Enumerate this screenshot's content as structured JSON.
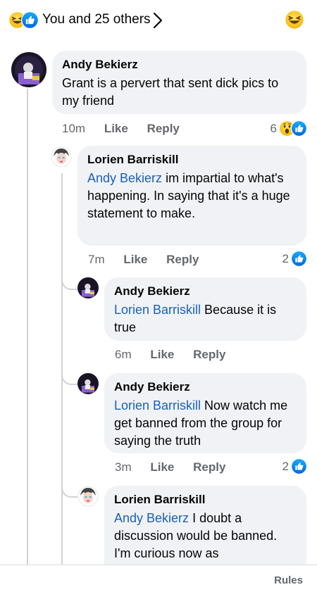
{
  "header": {
    "reaction_icons": [
      "laugh-icon",
      "like-icon"
    ],
    "summary": "You and 25 others",
    "right_emoji": "laugh-icon"
  },
  "comments": [
    {
      "author": "Andy Bekierz",
      "mention": "",
      "text": "Grant is a pervert that sent dick pics to my friend",
      "time": "10m",
      "like": "Like",
      "reply": "Reply",
      "reaction_count": "6",
      "reaction_icons": [
        "wow-icon",
        "like-icon"
      ]
    },
    {
      "author": "Lorien Barriskill",
      "mention": "Andy Bekierz",
      "text": " im impartial to what's happening. In saying that it's a huge statement to make.",
      "time": "7m",
      "like": "Like",
      "reply": "Reply",
      "reaction_count": "2",
      "reaction_icons": [
        "like-icon"
      ]
    },
    {
      "author": "Andy Bekierz",
      "mention": "Lorien Barriskill",
      "text": " Because it is true",
      "time": "6m",
      "like": "Like",
      "reply": "Reply",
      "reaction_count": "",
      "reaction_icons": []
    },
    {
      "author": "Andy Bekierz",
      "mention": "Lorien Barriskill",
      "text": " Now watch me get banned from the group for saying the truth",
      "time": "3m",
      "like": "Like",
      "reply": "Reply",
      "reaction_count": "2",
      "reaction_icons": [
        "like-icon"
      ]
    },
    {
      "author": "Lorien Barriskill",
      "mention": "Andy Bekierz",
      "text": " I doubt a discussion would be banned. I'm curious now as",
      "time": "",
      "like": "",
      "reply": "",
      "reaction_count": "",
      "reaction_icons": []
    }
  ],
  "footer": {
    "rules": "Rules"
  },
  "colors": {
    "mention": "#1b61b8",
    "like_blue": "#1877f2",
    "bubble": "#f0f2f5"
  }
}
